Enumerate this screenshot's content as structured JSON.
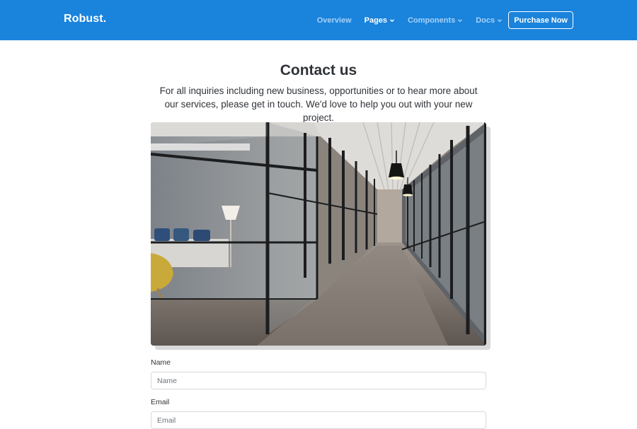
{
  "navbar": {
    "brand": "Robust.",
    "items": [
      {
        "label": "Overview",
        "dropdown": false,
        "active": false
      },
      {
        "label": "Pages",
        "dropdown": true,
        "active": true
      },
      {
        "label": "Components",
        "dropdown": true,
        "active": false
      },
      {
        "label": "Docs",
        "dropdown": true,
        "active": false
      }
    ],
    "cta_label": "Purchase Now"
  },
  "main": {
    "title": "Contact us",
    "subtitle": "For all inquiries including new business, opportunities or to hear more about our services, please get in touch. We'd love to help you out with your new project.",
    "image_icon": "office-hallway-photo"
  },
  "form": {
    "name_label": "Name",
    "name_placeholder": "Name",
    "email_label": "Email",
    "email_placeholder": "Email"
  },
  "colors": {
    "navbar_bg": "#1a83dc",
    "nav_inactive": "#a8d1f6",
    "text": "#2f3338"
  }
}
